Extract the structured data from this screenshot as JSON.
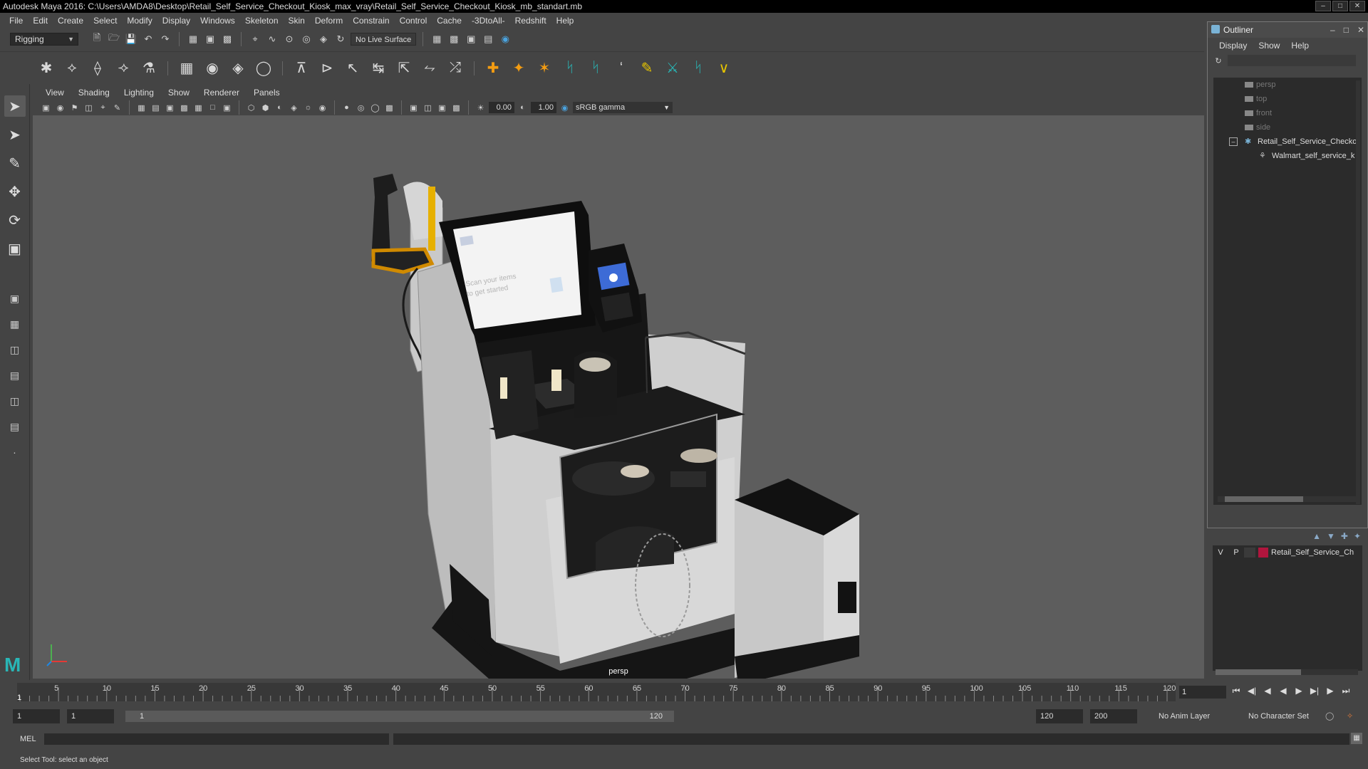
{
  "window": {
    "title": "Autodesk Maya 2016: C:\\Users\\AMDA8\\Desktop\\Retail_Self_Service_Checkout_Kiosk_max_vray\\Retail_Self_Service_Checkout_Kiosk_mb_standart.mb"
  },
  "menubar": {
    "items": [
      "File",
      "Edit",
      "Create",
      "Select",
      "Modify",
      "Display",
      "Windows",
      "Skeleton",
      "Skin",
      "Deform",
      "Constrain",
      "Control",
      "Cache",
      "-3DtoAll-",
      "Redshift",
      "Help"
    ]
  },
  "status_line": {
    "mode": "Rigging",
    "live_surface": "No Live Surface"
  },
  "viewport": {
    "menus": [
      "View",
      "Shading",
      "Lighting",
      "Show",
      "Renderer",
      "Panels"
    ],
    "exposure": "0.00",
    "gamma": "1.00",
    "color_space": "sRGB gamma",
    "camera_label": "persp"
  },
  "outliner": {
    "title": "Outliner",
    "menus": [
      "Display",
      "Show",
      "Help"
    ],
    "cameras": [
      "persp",
      "top",
      "front",
      "side"
    ],
    "group": "Retail_Self_Service_Checko",
    "child": "Walmart_self_service_k"
  },
  "layers": {
    "v": "V",
    "p": "P",
    "name": "Retail_Self_Service_Ch"
  },
  "timeline": {
    "ticks": [
      "5",
      "10",
      "15",
      "20",
      "25",
      "30",
      "35",
      "40",
      "45",
      "50",
      "55",
      "60",
      "65",
      "70",
      "75",
      "80",
      "85",
      "90",
      "95",
      "100",
      "105",
      "110",
      "115",
      "120"
    ],
    "start_marker": "1",
    "current_frame": "1"
  },
  "range": {
    "start": "1",
    "playback_start": "1",
    "slider_start": "1",
    "slider_end": "120",
    "playback_end": "120",
    "end": "200",
    "anim_layer": "No Anim Layer",
    "character_set": "No Character Set"
  },
  "command_line": {
    "label": "MEL"
  },
  "help_line": {
    "text": "Select Tool: select an object"
  }
}
